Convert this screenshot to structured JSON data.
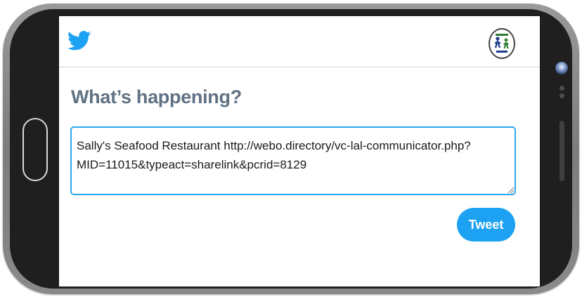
{
  "screen": {
    "header": {
      "logo_icon": "twitter-bird-icon",
      "avatar_icon": "profile-avatar-icon"
    },
    "heading": "What’s happening?",
    "composer": {
      "text": "Sally's Seafood Restaurant http://webo.directory/vc-lal-communicator.php?MID=11015&typeact=sharelink&pcrid=8129"
    },
    "tweet_button_label": "Tweet"
  },
  "colors": {
    "twitter_blue": "#1da1f2",
    "heading_gray": "#5f7183",
    "input_border": "#2aa9ea"
  }
}
